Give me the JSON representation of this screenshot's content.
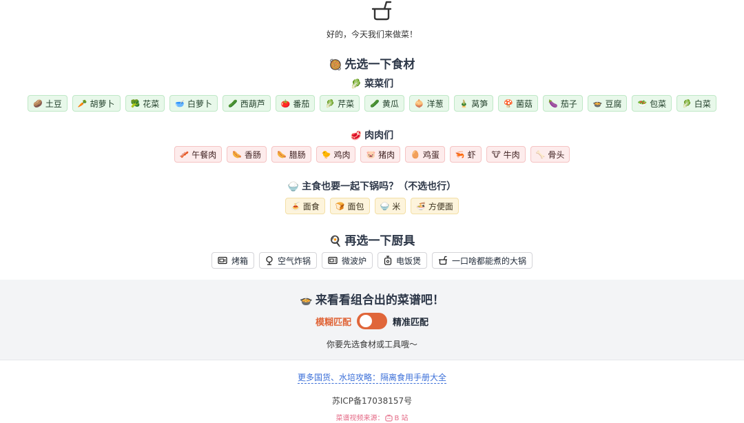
{
  "header": {
    "icon": "pot-icon",
    "greeting": "好的，今天我们来做菜！"
  },
  "ingredients": {
    "title_emoji": "🥘",
    "title": "先选一下食材",
    "vegetables": {
      "emoji": "🥬",
      "title": "菜菜们",
      "items": [
        {
          "emoji": "🥔",
          "label": "土豆"
        },
        {
          "emoji": "🥕",
          "label": "胡萝卜"
        },
        {
          "emoji": "🥦",
          "label": "花菜"
        },
        {
          "emoji": "🥣",
          "label": "白萝卜"
        },
        {
          "emoji": "🥒",
          "label": "西葫芦"
        },
        {
          "emoji": "🍅",
          "label": "番茄"
        },
        {
          "emoji": "🥬",
          "label": "芹菜"
        },
        {
          "emoji": "🥒",
          "label": "黄瓜"
        },
        {
          "emoji": "🧅",
          "label": "洋葱"
        },
        {
          "emoji": "🎍",
          "label": "莴笋"
        },
        {
          "emoji": "🍄",
          "label": "菌菇"
        },
        {
          "emoji": "🍆",
          "label": "茄子"
        },
        {
          "emoji": "🍲",
          "label": "豆腐"
        },
        {
          "emoji": "🥗",
          "label": "包菜"
        },
        {
          "emoji": "🥬",
          "label": "白菜"
        }
      ]
    },
    "meats": {
      "emoji": "🥩",
      "title": "肉肉们",
      "items": [
        {
          "emoji": "🥓",
          "label": "午餐肉"
        },
        {
          "emoji": "🌭",
          "label": "香肠"
        },
        {
          "emoji": "🌭",
          "label": "腊肠"
        },
        {
          "emoji": "🐤",
          "label": "鸡肉"
        },
        {
          "emoji": "🐷",
          "label": "猪肉"
        },
        {
          "emoji": "🥚",
          "label": "鸡蛋"
        },
        {
          "emoji": "🦐",
          "label": "虾"
        },
        {
          "emoji": "🐮",
          "label": "牛肉"
        },
        {
          "emoji": "🦴",
          "label": "骨头"
        }
      ]
    },
    "staples": {
      "emoji": "🍚",
      "title": "主食也要一起下锅吗？（不选也行）",
      "items": [
        {
          "emoji": "🍝",
          "label": "面食"
        },
        {
          "emoji": "🍞",
          "label": "面包"
        },
        {
          "emoji": "🍚",
          "label": "米"
        },
        {
          "emoji": "🍜",
          "label": "方便面"
        }
      ]
    }
  },
  "tools": {
    "title_emoji": "🍳",
    "title": "再选一下厨具",
    "items": [
      {
        "icon": "oven-icon",
        "label": "烤箱"
      },
      {
        "icon": "air-fryer-icon",
        "label": "空气炸锅"
      },
      {
        "icon": "microwave-icon",
        "label": "微波炉"
      },
      {
        "icon": "rice-cooker-icon",
        "label": "电饭煲"
      },
      {
        "icon": "pot-icon",
        "label": "一口啥都能煮的大锅"
      }
    ]
  },
  "result": {
    "title_emoji": "🍲",
    "title": "来看看组合出的菜谱吧！",
    "mode_fuzzy": "模糊匹配",
    "mode_exact": "精准匹配",
    "toggle_state": "fuzzy",
    "accent_color": "#e0663a",
    "hint": "你要先选食材或工具哦～"
  },
  "footer": {
    "link_text": "更多国货、水培攻略：隔离食用手册大全",
    "icp": "苏ICP备17038157号",
    "source_prefix": "菜谱视频来源：",
    "source_icon": "tv-icon",
    "source_name": "B 站"
  }
}
